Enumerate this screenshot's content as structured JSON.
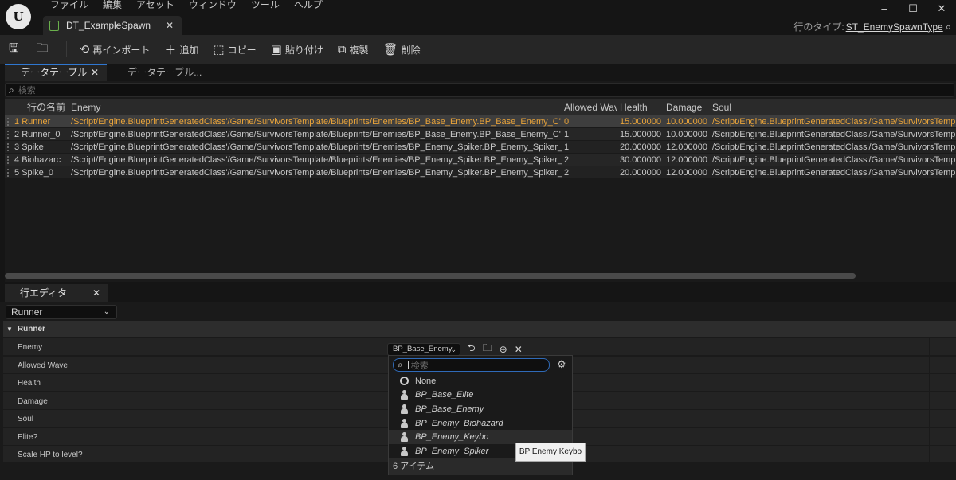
{
  "window": {
    "menu": [
      "ファイル",
      "編集",
      "アセット",
      "ウィンドウ",
      "ツール",
      "ヘルプ"
    ],
    "tab_title": "DT_ExampleSpawn",
    "row_type_label": "行のタイプ:",
    "row_type_value": "ST_EnemySpawnType",
    "controls": {
      "minimize": "–",
      "maximize": "☐",
      "close": "✕"
    }
  },
  "toolbar": {
    "reimport": "再インポート",
    "add": "追加",
    "copy": "コピー",
    "paste": "貼り付け",
    "duplicate": "複製",
    "delete": "削除"
  },
  "data_table": {
    "tab_active": "データテーブル",
    "tab_inactive": "データテーブル...",
    "search_placeholder": "検索",
    "columns": [
      "行の名前",
      "Enemy",
      "Allowed Wave",
      "Health",
      "Damage",
      "Soul"
    ],
    "rows": [
      {
        "index": "1",
        "name": "Runner",
        "enemy": "/Script/Engine.BlueprintGeneratedClass'/Game/SurvivorsTemplate/Blueprints/Enemies/BP_Base_Enemy.BP_Base_Enemy_C'",
        "wave": "0",
        "health": "15.000000",
        "damage": "10.000000",
        "soul": "/Script/Engine.BlueprintGeneratedClass'/Game/SurvivorsTemplate/Bl"
      },
      {
        "index": "2",
        "name": "Runner_0",
        "enemy": "/Script/Engine.BlueprintGeneratedClass'/Game/SurvivorsTemplate/Blueprints/Enemies/BP_Base_Enemy.BP_Base_Enemy_C'",
        "wave": "1",
        "health": "15.000000",
        "damage": "10.000000",
        "soul": "/Script/Engine.BlueprintGeneratedClass'/Game/SurvivorsTemplate/Bl"
      },
      {
        "index": "3",
        "name": "Spike",
        "enemy": "/Script/Engine.BlueprintGeneratedClass'/Game/SurvivorsTemplate/Blueprints/Enemies/BP_Enemy_Spiker.BP_Enemy_Spiker_C'",
        "wave": "1",
        "health": "20.000000",
        "damage": "12.000000",
        "soul": "/Script/Engine.BlueprintGeneratedClass'/Game/SurvivorsTemplate/Bl"
      },
      {
        "index": "4",
        "name": "Biohazarc",
        "enemy": "/Script/Engine.BlueprintGeneratedClass'/Game/SurvivorsTemplate/Blueprints/Enemies/BP_Enemy_Spiker.BP_Enemy_Spiker_C'",
        "wave": "2",
        "health": "30.000000",
        "damage": "12.000000",
        "soul": "/Script/Engine.BlueprintGeneratedClass'/Game/SurvivorsTemplate/Bl"
      },
      {
        "index": "5",
        "name": "Spike_0",
        "enemy": "/Script/Engine.BlueprintGeneratedClass'/Game/SurvivorsTemplate/Blueprints/Enemies/BP_Enemy_Spiker.BP_Enemy_Spiker_C'",
        "wave": "2",
        "health": "20.000000",
        "damage": "12.000000",
        "soul": "/Script/Engine.BlueprintGeneratedClass'/Game/SurvivorsTemplate/Bl"
      }
    ]
  },
  "row_editor": {
    "tab": "行エディタ",
    "selected_row": "Runner",
    "section": "Runner",
    "properties": [
      "Enemy",
      "Allowed Wave",
      "Health",
      "Damage",
      "Soul",
      "Elite?",
      "Scale HP to level?"
    ],
    "enemy_value": "BP_Base_Enemy"
  },
  "picker": {
    "search_placeholder": "検索",
    "items": [
      "None",
      "BP_Base_Elite",
      "BP_Base_Enemy",
      "BP_Enemy_Biohazard",
      "BP_Enemy_Keybo",
      "BP_Enemy_Spiker"
    ],
    "count": "6 アイテム",
    "tooltip": "BP Enemy Keybo"
  },
  "colors": {
    "accent": "#2f77d1",
    "selected_text": "#e8a33a"
  }
}
